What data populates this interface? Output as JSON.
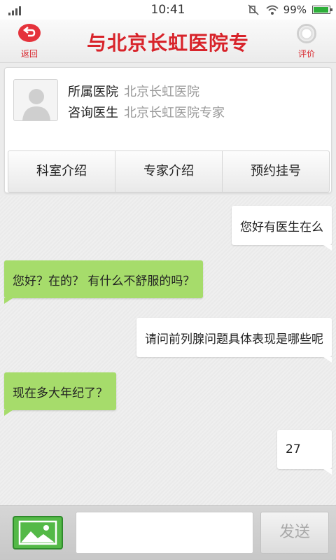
{
  "status_bar": {
    "time": "10:41",
    "battery_percent": "99%",
    "battery_level": 0.99
  },
  "header": {
    "back_label": "返回",
    "title": "与北京长虹医院专",
    "rate_label": "评价",
    "accent_color": "#d8232a"
  },
  "card": {
    "hospital_label": "所属医院",
    "hospital_value": "北京长虹医院",
    "doctor_label": "咨询医生",
    "doctor_value": "北京长虹医院专家",
    "tabs": [
      {
        "label": "科室介绍"
      },
      {
        "label": "专家介绍"
      },
      {
        "label": "预约挂号"
      }
    ]
  },
  "messages": [
    {
      "side": "right",
      "text": "您好有医生在么"
    },
    {
      "side": "left",
      "text": "您好？在的？ 有什么不舒服的吗？"
    },
    {
      "side": "right",
      "text": "请问前列腺问题具体表现是哪些呢"
    },
    {
      "side": "left",
      "text": "现在多大年纪了？"
    },
    {
      "side": "right",
      "text": "27"
    }
  ],
  "input_bar": {
    "message_value": "",
    "send_label": "发送",
    "image_icon": "image-icon"
  }
}
